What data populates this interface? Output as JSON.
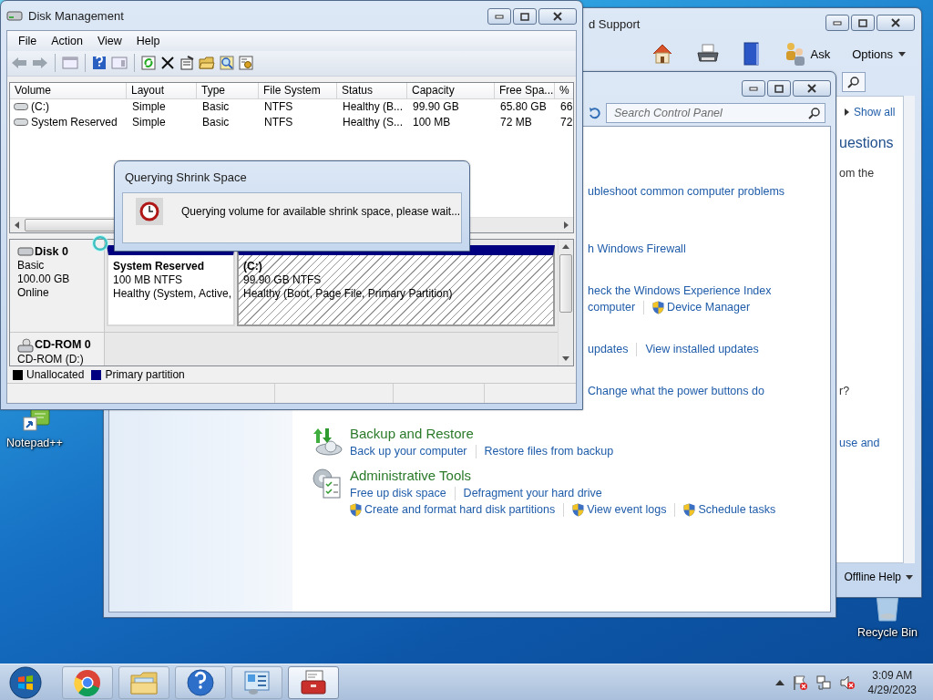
{
  "help_window": {
    "title": "d Support",
    "ask_label": "Ask",
    "options_label": "Options",
    "show_all": "Show all",
    "pane_texts": [
      {
        "kind": "heading",
        "text": "uestions"
      },
      {
        "kind": "text",
        "text": "om the"
      },
      {
        "kind": "text",
        "text": "r?"
      },
      {
        "kind": "link",
        "text": "use and"
      }
    ],
    "footer": "Offline Help"
  },
  "control_panel": {
    "search": {
      "placeholder": "Search Control Panel"
    },
    "covered_sections": [
      {
        "lines": [
          [
            {
              "text": "ubleshoot common computer problems",
              "shield": false
            }
          ]
        ]
      },
      {
        "lines": [
          [
            {
              "text": "h Windows Firewall",
              "shield": false
            }
          ]
        ]
      },
      {
        "lines": [
          [
            {
              "text": "heck the Windows Experience Index",
              "shield": false
            }
          ],
          [
            {
              "text": "computer",
              "shield": false
            },
            {
              "text": "Device Manager",
              "shield": true
            }
          ]
        ]
      },
      {
        "lines": [
          [
            {
              "text": "updates",
              "shield": false
            },
            {
              "text": "View installed updates",
              "shield": false
            }
          ]
        ]
      },
      {
        "lines": [
          [
            {
              "text": "Change what the power buttons do",
              "shield": false
            }
          ]
        ]
      }
    ],
    "sections": [
      {
        "kind": "backup",
        "heading": "Backup and Restore",
        "lines": [
          [
            {
              "text": "Back up your computer",
              "shield": false
            },
            {
              "text": "Restore files from backup",
              "shield": false
            }
          ]
        ]
      },
      {
        "kind": "admin",
        "heading": "Administrative Tools",
        "lines": [
          [
            {
              "text": "Free up disk space",
              "shield": false
            },
            {
              "text": "Defragment your hard drive",
              "shield": false
            }
          ],
          [
            {
              "text": "Create and format hard disk partitions",
              "shield": true
            },
            {
              "text": "View event logs",
              "shield": true
            },
            {
              "text": "Schedule tasks",
              "shield": true
            }
          ]
        ]
      }
    ]
  },
  "disk_management": {
    "title": "Disk Management",
    "menu": [
      "File",
      "Action",
      "View",
      "Help"
    ],
    "columns": [
      "Volume",
      "Layout",
      "Type",
      "File System",
      "Status",
      "Capacity",
      "Free Spa...",
      "%"
    ],
    "volumes": [
      {
        "cells": [
          "(C:)",
          "Simple",
          "Basic",
          "NTFS",
          "Healthy (B...",
          "99.90 GB",
          "65.80 GB",
          "66"
        ]
      },
      {
        "cells": [
          "System Reserved",
          "Simple",
          "Basic",
          "NTFS",
          "Healthy (S...",
          "100 MB",
          "72 MB",
          "72"
        ]
      }
    ],
    "disks": [
      {
        "kind": "disk",
        "name": "Disk 0",
        "details": [
          "Basic",
          "100.00 GB",
          "Online"
        ],
        "partitions": [
          {
            "name": "System Reserved",
            "size": "100 MB NTFS",
            "status": "Healthy (System, Active,",
            "selected": false
          },
          {
            "name": "(C:)",
            "size": "99.90 GB NTFS",
            "status": "Healthy (Boot, Page File, Primary Partition)",
            "selected": true
          }
        ]
      },
      {
        "kind": "cdrom",
        "name": "CD-ROM 0",
        "details": [
          "CD-ROM (D:)"
        ]
      }
    ],
    "legend": [
      {
        "label": "Unallocated",
        "color": "#000000"
      },
      {
        "label": "Primary partition",
        "color": "#000080"
      }
    ]
  },
  "dialog": {
    "title": "Querying Shrink Space",
    "message": "Querying volume for available shrink space, please wait..."
  },
  "desktop_icons": [
    {
      "kind": "notepad",
      "label": "Notepad++"
    },
    {
      "kind": "recycle",
      "label": "Recycle Bin"
    }
  ],
  "taskbar": {
    "apps": [
      {
        "kind": "browser",
        "selected": false
      },
      {
        "kind": "explorer",
        "selected": false
      },
      {
        "kind": "help",
        "selected": false
      },
      {
        "kind": "control_panel",
        "selected": false
      },
      {
        "kind": "toolbox",
        "selected": true
      }
    ],
    "time": "3:09 AM",
    "date": "4/29/2023"
  }
}
